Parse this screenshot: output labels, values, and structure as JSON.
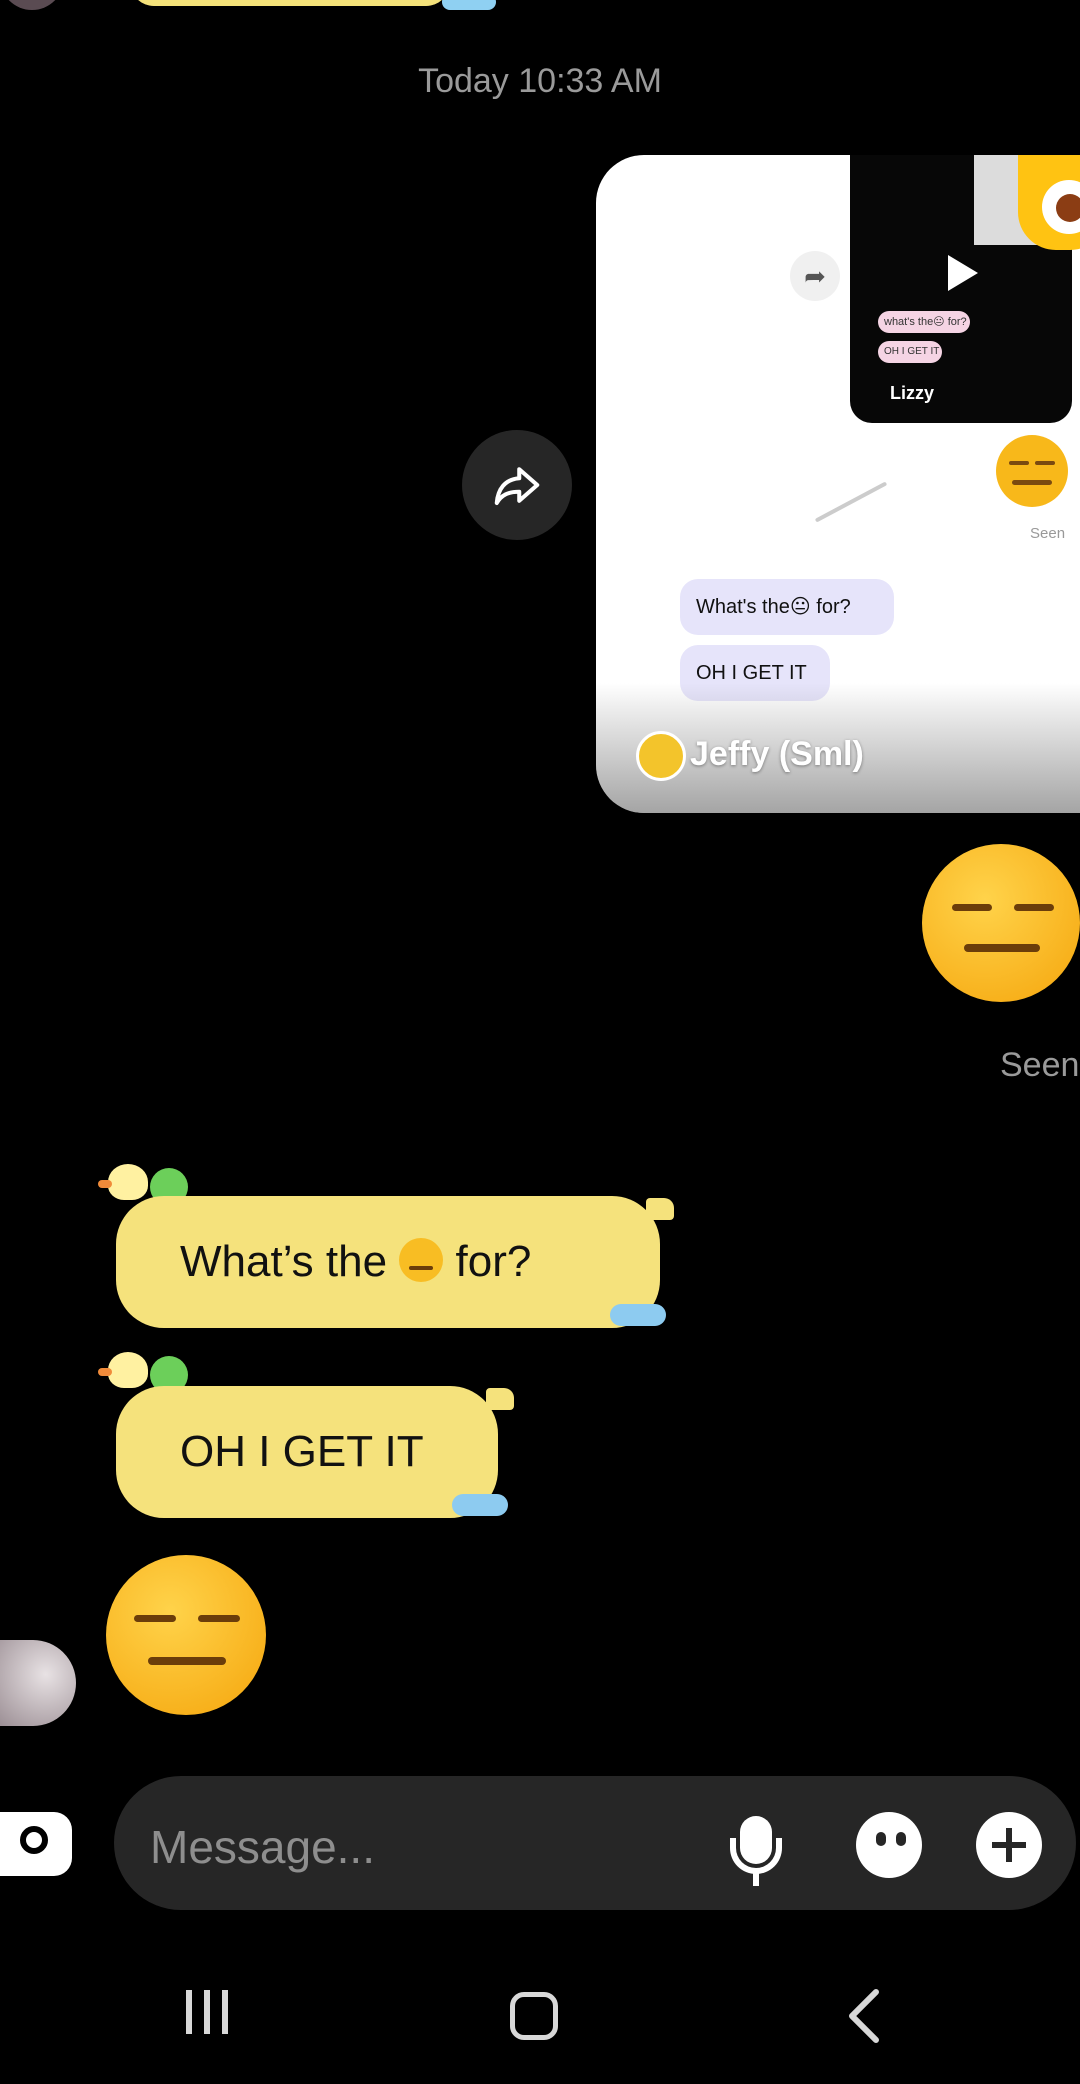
{
  "thread": {
    "timestamp": "Today 10:33 AM"
  },
  "shared_post": {
    "author": "Jeffy (Sml)",
    "preview": {
      "inner_user": "Lizzy",
      "seen_label": "Seen",
      "bubble_1": "What's the😐 for?",
      "bubble_2": "OH I GET IT",
      "mini_bubble_1": "what's the😐 for?",
      "mini_bubble_2": "OH I GET IT"
    }
  },
  "messages": {
    "seen_label": "Seen",
    "incoming_1_before": "What’s the",
    "incoming_1_after": "for?",
    "incoming_2": "OH I GET IT"
  },
  "composer": {
    "placeholder": "Message..."
  },
  "icons": {
    "camera": "camera-icon",
    "mic": "microphone-icon",
    "sticker": "sticker-icon",
    "plus": "plus-icon",
    "share": "share-forward-icon"
  },
  "colors": {
    "background": "#000000",
    "bubble_yellow": "#f5e27c",
    "composer_bg": "#262626"
  }
}
